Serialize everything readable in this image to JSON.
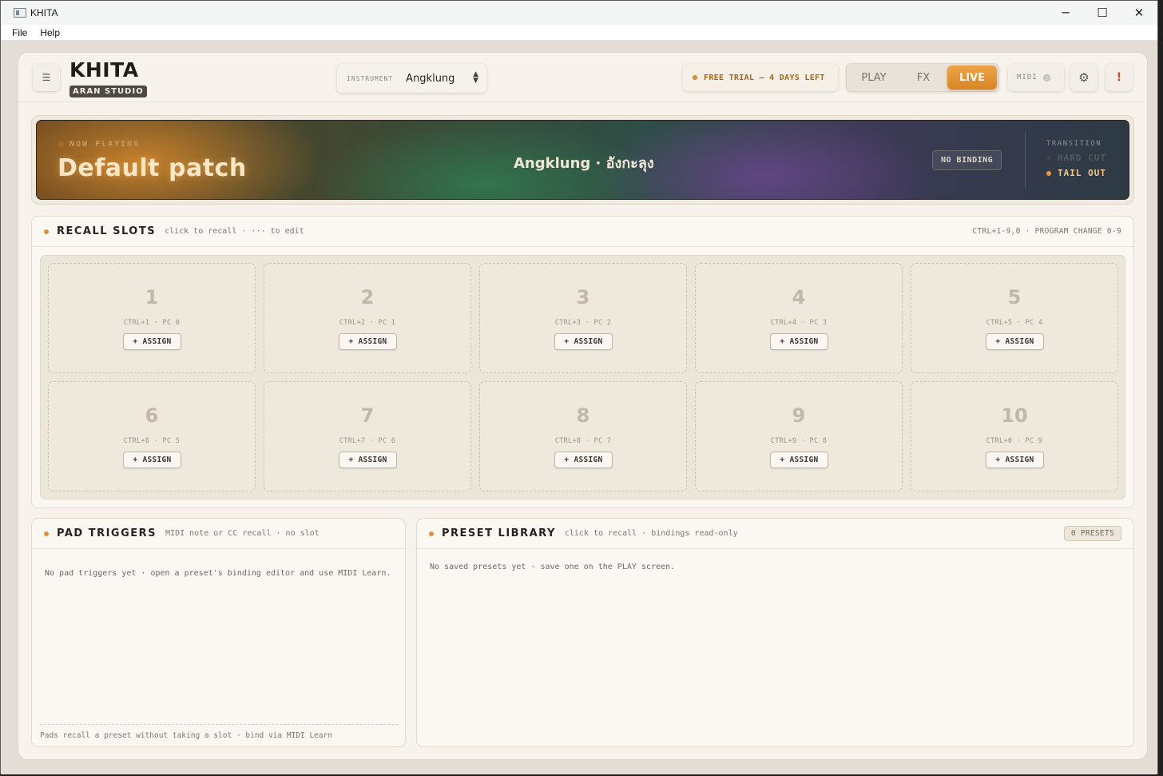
{
  "window": {
    "title": "KHITA",
    "controls": {
      "minimize": "─",
      "maximize": "☐",
      "close": "✕"
    }
  },
  "menu": [
    "File",
    "Help"
  ],
  "header": {
    "menu_icon": "☰",
    "logo_title": "KHITA",
    "logo_badge": "ARAN STUDIO",
    "instrument_label": "INSTRUMENT",
    "instrument_value": "Angklung",
    "instrument_arrows": "▲▼",
    "trial_text": "FREE TRIAL — 4 DAYS LEFT",
    "modes": {
      "play": "PLAY",
      "fx": "FX",
      "live": "LIVE"
    },
    "active_mode": "LIVE",
    "midi_label": "MIDI",
    "settings_icon": "⚙",
    "alert_icon": "!"
  },
  "now_playing": {
    "label": "NOW PLAYING",
    "patch": "Default patch",
    "instrument": "Angklung · อังกะลุง",
    "binding": "NO BINDING",
    "transition_label": "TRANSITION",
    "transition_options": [
      "HARD CUT",
      "TAIL OUT"
    ],
    "transition_selected": "TAIL OUT"
  },
  "recall_slots": {
    "title": "RECALL SLOTS",
    "subtitle": "click to recall · ··· to edit",
    "shortcut_hint": "CTRL+1-9,0 · PROGRAM CHANGE 0-9",
    "assign_label": "+ ASSIGN",
    "slots": [
      {
        "number": "1",
        "keys": "CTRL+1 · PC 0"
      },
      {
        "number": "2",
        "keys": "CTRL+2 · PC 1"
      },
      {
        "number": "3",
        "keys": "CTRL+3 · PC 2"
      },
      {
        "number": "4",
        "keys": "CTRL+4 · PC 3"
      },
      {
        "number": "5",
        "keys": "CTRL+5 · PC 4"
      },
      {
        "number": "6",
        "keys": "CTRL+6 · PC 5"
      },
      {
        "number": "7",
        "keys": "CTRL+7 · PC 6"
      },
      {
        "number": "8",
        "keys": "CTRL+8 · PC 7"
      },
      {
        "number": "9",
        "keys": "CTRL+9 · PC 8"
      },
      {
        "number": "10",
        "keys": "CTRL+0 · PC 9"
      }
    ]
  },
  "pad_triggers": {
    "title": "PAD TRIGGERS",
    "subtitle": "MIDI note or CC recall · no slot",
    "empty_message": "No pad triggers yet · open a preset's binding editor and use MIDI Learn.",
    "footer": "Pads recall a preset without taking a slot · bind via MIDI Learn"
  },
  "preset_library": {
    "title": "PRESET LIBRARY",
    "subtitle": "click to recall · bindings read-only",
    "count_badge": "0 PRESETS",
    "empty_message": "No saved presets yet · save one on the PLAY screen."
  },
  "colors": {
    "accent": "#e0903a",
    "live_button": "#d98623",
    "alert": "#d2462b",
    "panel_bg": "#fbf8f3"
  }
}
